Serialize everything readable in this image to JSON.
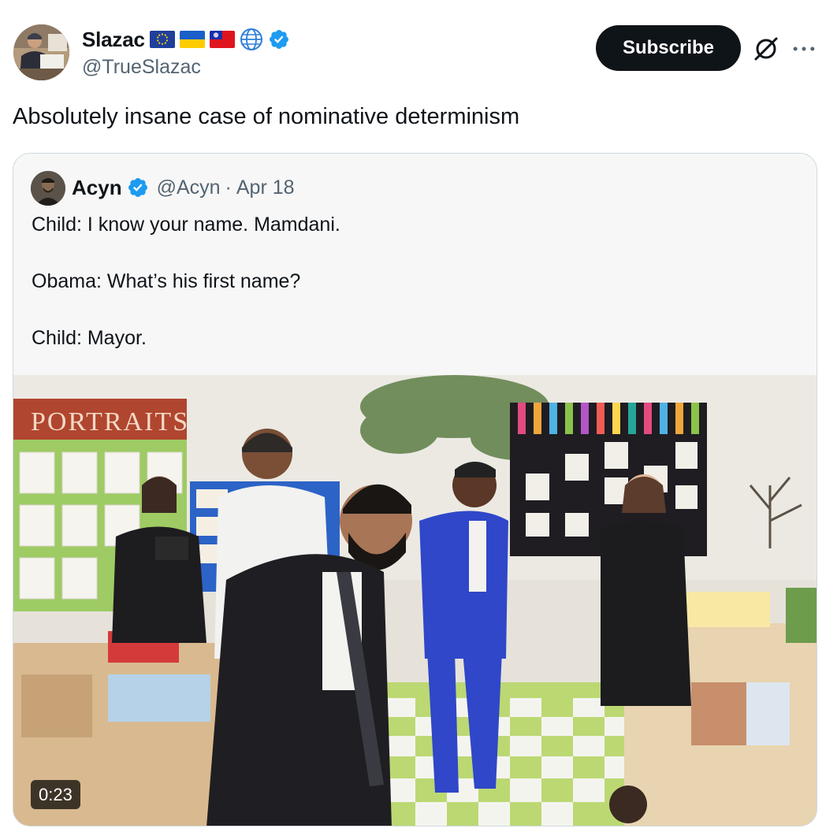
{
  "post": {
    "author": {
      "display_name": "Slazac",
      "handle": "@TrueSlazac",
      "badges": [
        "eu-flag-icon",
        "ukraine-flag-icon",
        "taiwan-flag-icon",
        "globe-icon",
        "verified-badge-icon"
      ]
    },
    "subscribe_label": "Subscribe",
    "actions": {
      "grok_icon": "grok-icon",
      "more_icon": "more-icon"
    },
    "text": "Absolutely insane case of nominative determinism"
  },
  "quote": {
    "author": {
      "display_name": "Acyn",
      "handle": "@Acyn",
      "separator": "·",
      "date": "Apr 18"
    },
    "lines": [
      "Child: I know your name. Mamdani.",
      "Obama: What’s his first name?",
      "Child: Mayor."
    ],
    "video": {
      "duration": "0:23",
      "wall_sign": "PORTRAITS"
    }
  },
  "colors": {
    "accent_verified": "#1d9bf0",
    "text_primary": "#0f1419",
    "text_secondary": "#536471",
    "button_bg": "#0f1419",
    "card_border": "#cfd9de"
  }
}
